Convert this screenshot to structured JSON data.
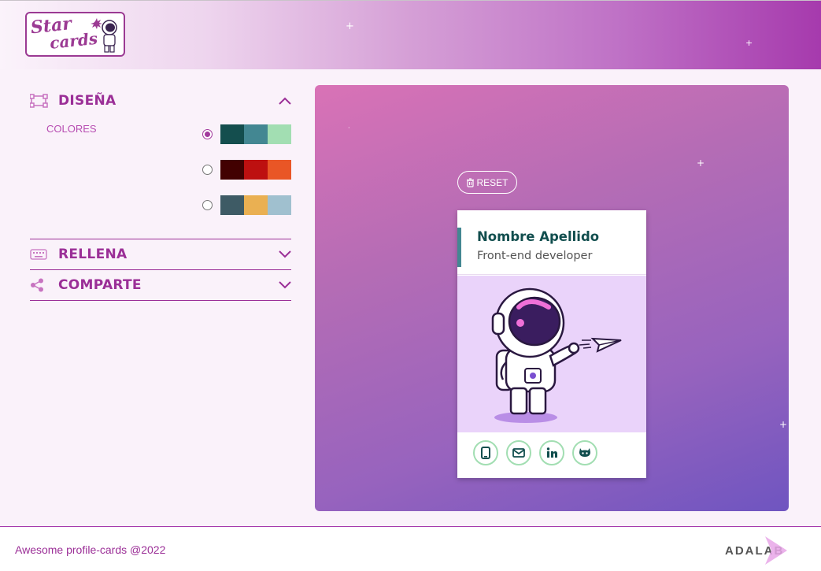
{
  "header": {
    "logo_line1": "Star",
    "logo_line2": "cards"
  },
  "panel": {
    "design": {
      "title": "DISEÑA",
      "colors_label": "COLORES",
      "expanded": true
    },
    "palettes": [
      {
        "selected": true,
        "colors": [
          "#144e4e",
          "#438792",
          "#a2deb2"
        ]
      },
      {
        "selected": false,
        "colors": [
          "#420101",
          "#bd1010",
          "#e95626"
        ]
      },
      {
        "selected": false,
        "colors": [
          "#3e5b65",
          "#eab052",
          "#a0c0cf"
        ]
      }
    ],
    "fill": {
      "title": "RELLENA"
    },
    "share": {
      "title": "COMPARTE"
    }
  },
  "preview": {
    "reset_label": "RESET",
    "card": {
      "name": "Nombre Apellido",
      "job": "Front-end developer"
    },
    "social_icons": [
      "phone-icon",
      "mail-icon",
      "linkedin-icon",
      "github-icon"
    ]
  },
  "footer": {
    "copyright": "Awesome profile-cards @2022",
    "brand": "ADALAB"
  },
  "colors": {
    "accent": "#9b2f97",
    "card_primary": "#114e4e",
    "card_border": "#a2deb2"
  }
}
